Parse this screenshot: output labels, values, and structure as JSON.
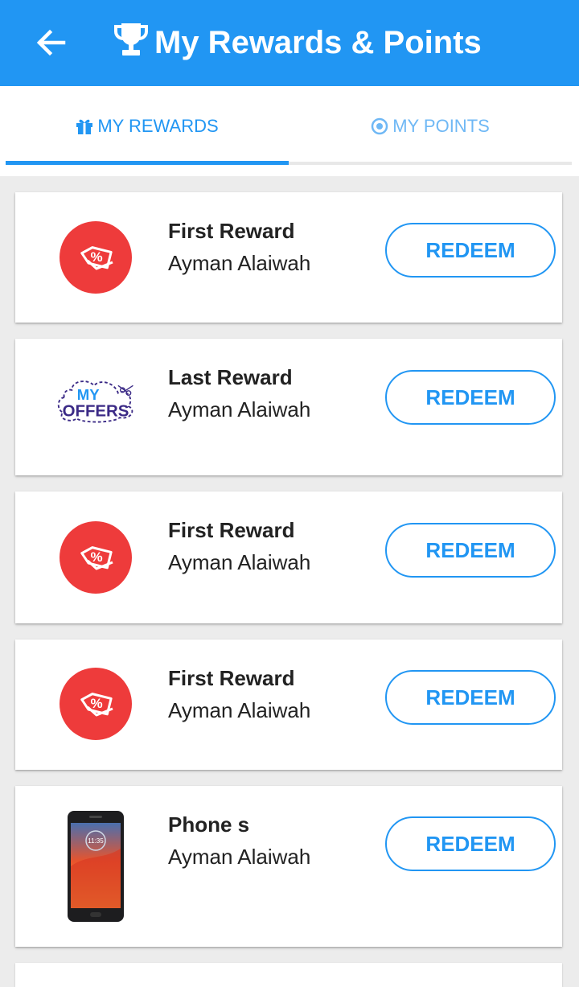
{
  "header": {
    "title": "My Rewards & Points",
    "back_icon": "arrow-left-icon",
    "title_icon": "trophy-icon",
    "color": "#2196F3"
  },
  "tabs": [
    {
      "label": "MY REWARDS",
      "icon": "gift-icon",
      "active": true
    },
    {
      "label": "MY POINTS",
      "icon": "target-icon",
      "active": false
    }
  ],
  "rewards": [
    {
      "title": "First Reward",
      "owner": "Ayman Alaiwah",
      "image": "discount-tag-icon",
      "action": "REDEEM"
    },
    {
      "title": "Last Reward",
      "owner": "Ayman Alaiwah",
      "image": "my-offers-logo",
      "image_text": [
        "MY",
        "OFFERS"
      ],
      "action": "REDEEM"
    },
    {
      "title": "First Reward",
      "owner": "Ayman Alaiwah",
      "image": "discount-tag-icon",
      "action": "REDEEM"
    },
    {
      "title": "First Reward",
      "owner": "Ayman Alaiwah",
      "image": "discount-tag-icon",
      "action": "REDEEM"
    },
    {
      "title": "Phone s",
      "owner": "Ayman Alaiwah",
      "image": "smartphone-image",
      "phone_time": "11:35",
      "action": "REDEEM"
    }
  ],
  "colors": {
    "accent": "#2196F3",
    "tag_red": "#ee3b3b",
    "logo_purple": "#3b2a86"
  }
}
